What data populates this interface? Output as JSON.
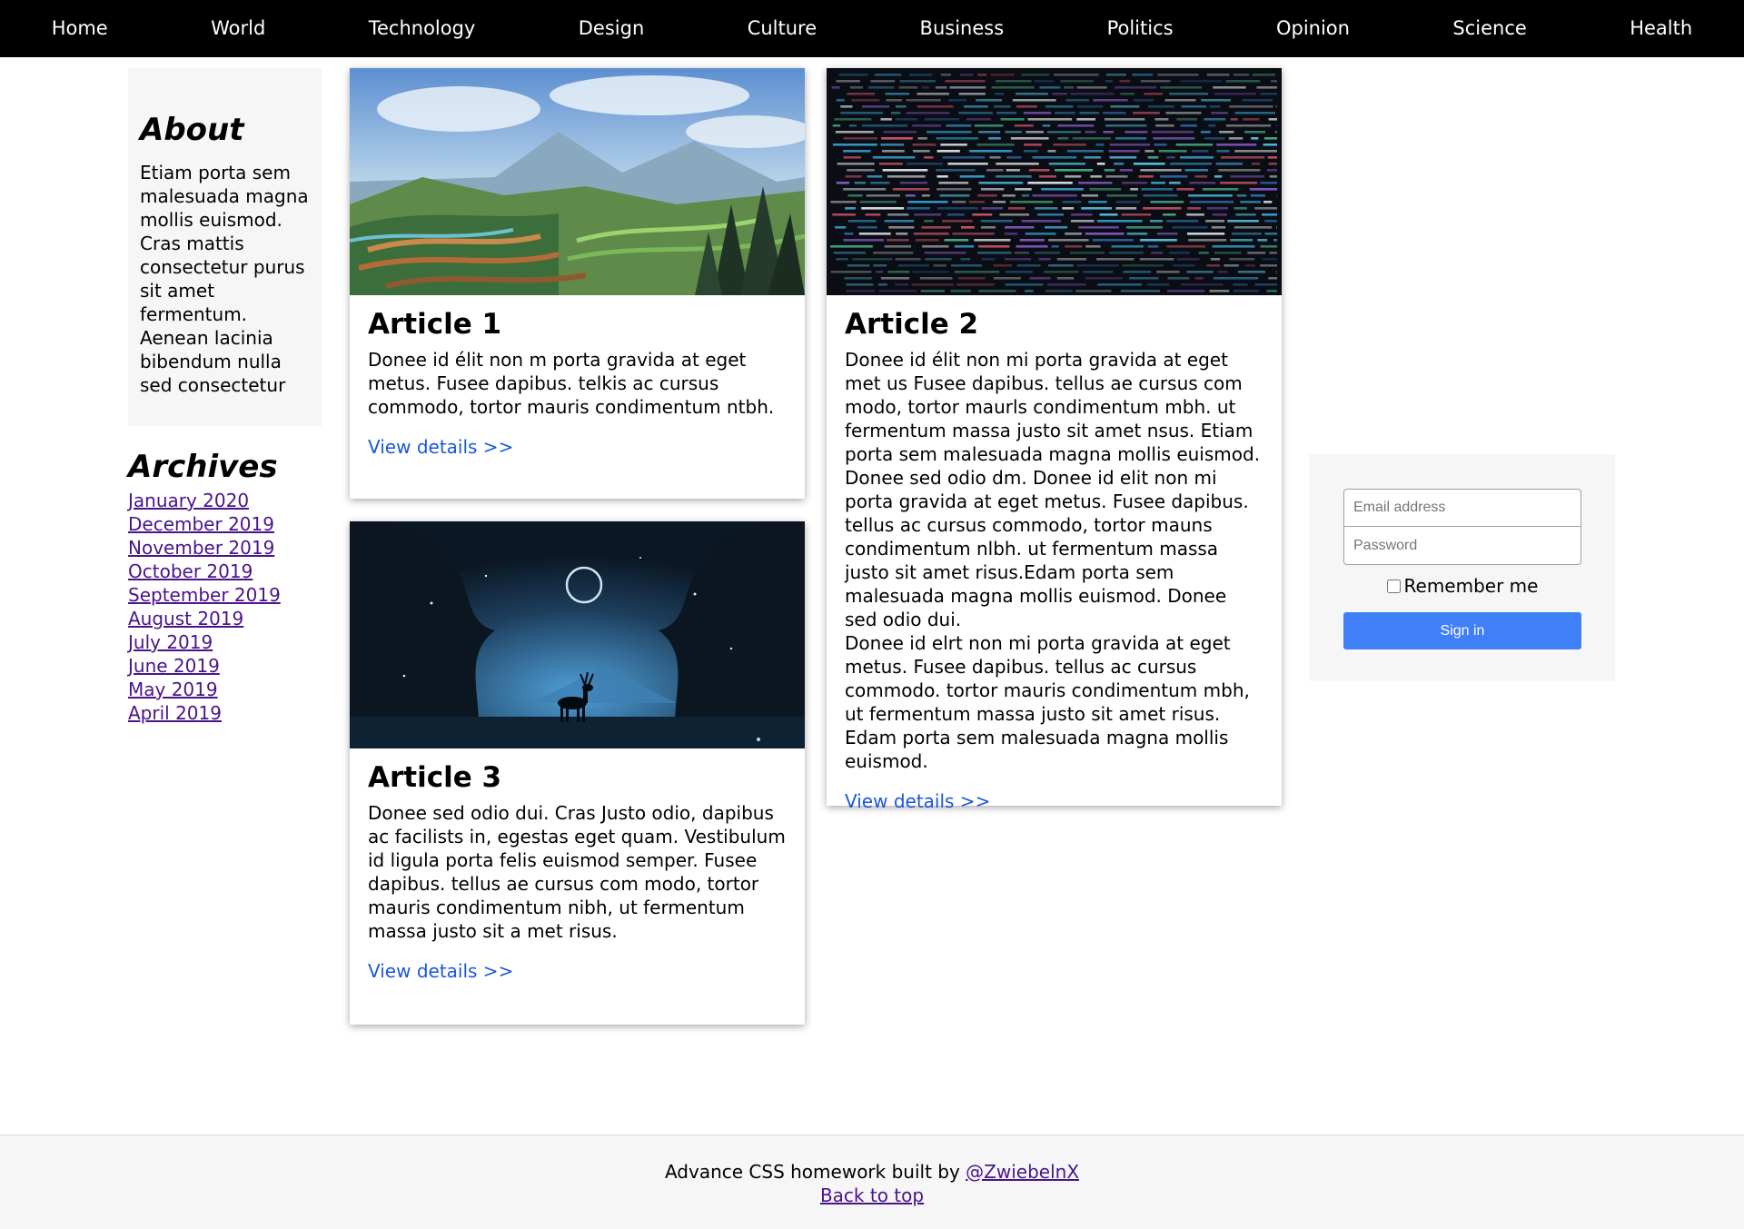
{
  "nav": {
    "items": [
      "Home",
      "World",
      "Technology",
      "Design",
      "Culture",
      "Business",
      "Politics",
      "Opinion",
      "Science",
      "Health"
    ]
  },
  "about": {
    "title": "About",
    "text": "Etiam porta sem malesuada magna mollis euismod. Cras mattis consectetur purus sit amet fermentum. Aenean lacinia bibendum nulla sed consectetur"
  },
  "archives": {
    "title": "Archives",
    "items": [
      "January 2020",
      "December 2019",
      "November 2019",
      "October 2019",
      "September 2019",
      "August 2019",
      "July 2019",
      "June 2019",
      "May 2019",
      "April 2019"
    ]
  },
  "articles": [
    {
      "title": "Article 1",
      "text": "Donee id élit non m porta gravida at eget metus. Fusee dapibus. telkis ac cursus commodo, tortor mauris condimentum ntbh.",
      "link": "View details >>"
    },
    {
      "title": "Article 2",
      "paragraphs": [
        "Donee id élit non mi porta gravida at eget met us Fusee dapibus. tellus ae cursus com modo, tortor maurls condimentum mbh. ut fermentum massa justo sit amet nsus. Etiam porta sem malesuada magna mollis euismod.",
        "Donee sed odio dm. Donee id elit non mi porta gravida at eget metus. Fusee dapibus. tellus ac cursus commodo, tortor mauns condimentum nlbh. ut fermentum massa justo sit amet risus.Edam porta sem malesuada magna mollis euismod. Donee sed odio dui.",
        "Donee id elrt non mi porta gravida at eget metus. Fusee dapibus. tellus ac cursus commodo. tortor mauris condimentum mbh, ut fermentum massa justo sit amet risus. Edam porta sem malesuada magna mollis euismod."
      ],
      "link": "View details >>"
    },
    {
      "title": "Article 3",
      "text": "Donee sed odio dui. Cras Justo odio, dapibus ac facilists in, egestas eget quam. Vestibulum id ligula porta felis euismod semper. Fusee dapibus. tellus ae cursus com modo, tortor mauris condimentum nibh, ut fermentum massa justo sit a met risus.",
      "link": "View details >>"
    }
  ],
  "signin": {
    "email_placeholder": "Email address",
    "password_placeholder": "Password",
    "remember_label": "Remember me",
    "button_label": "Sign in"
  },
  "footer": {
    "text": "Advance CSS homework built by ",
    "author_link": "@ZwiebelnX",
    "back_to_top": "Back to top"
  },
  "colors": {
    "nav_bg": "#000000",
    "link_visited": "#4a148c",
    "card_link": "#1a56db",
    "button_bg": "#3f7ff8",
    "panel_bg": "#f6f6f6"
  }
}
